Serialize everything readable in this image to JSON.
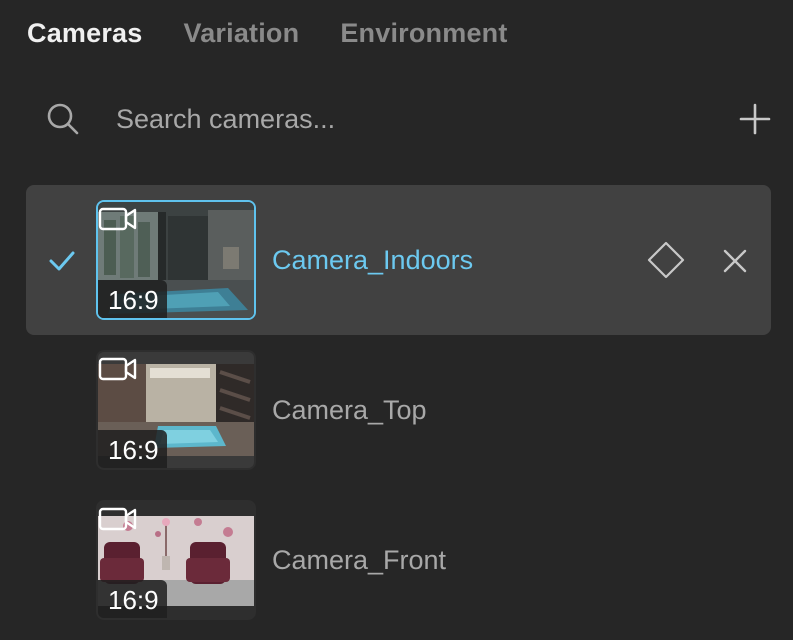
{
  "tabs": [
    {
      "label": "Cameras",
      "active": true
    },
    {
      "label": "Variation",
      "active": false
    },
    {
      "label": "Environment",
      "active": false
    }
  ],
  "search": {
    "placeholder": "Search cameras...",
    "value": "",
    "icon": "search-icon"
  },
  "add_icon": "plus-icon",
  "cameras": [
    {
      "name": "Camera_Indoors",
      "ratio": "16:9",
      "selected": true,
      "icon": "video-camera-icon"
    },
    {
      "name": "Camera_Top",
      "ratio": "16:9",
      "selected": false,
      "icon": "video-camera-icon"
    },
    {
      "name": "Camera_Front",
      "ratio": "16:9",
      "selected": false,
      "icon": "video-camera-icon"
    }
  ],
  "colors": {
    "background": "#262626",
    "selected_row": "#414141",
    "accent": "#6cc9f0",
    "text_muted": "#a8a8a8",
    "text_active": "#f0f0f0"
  }
}
